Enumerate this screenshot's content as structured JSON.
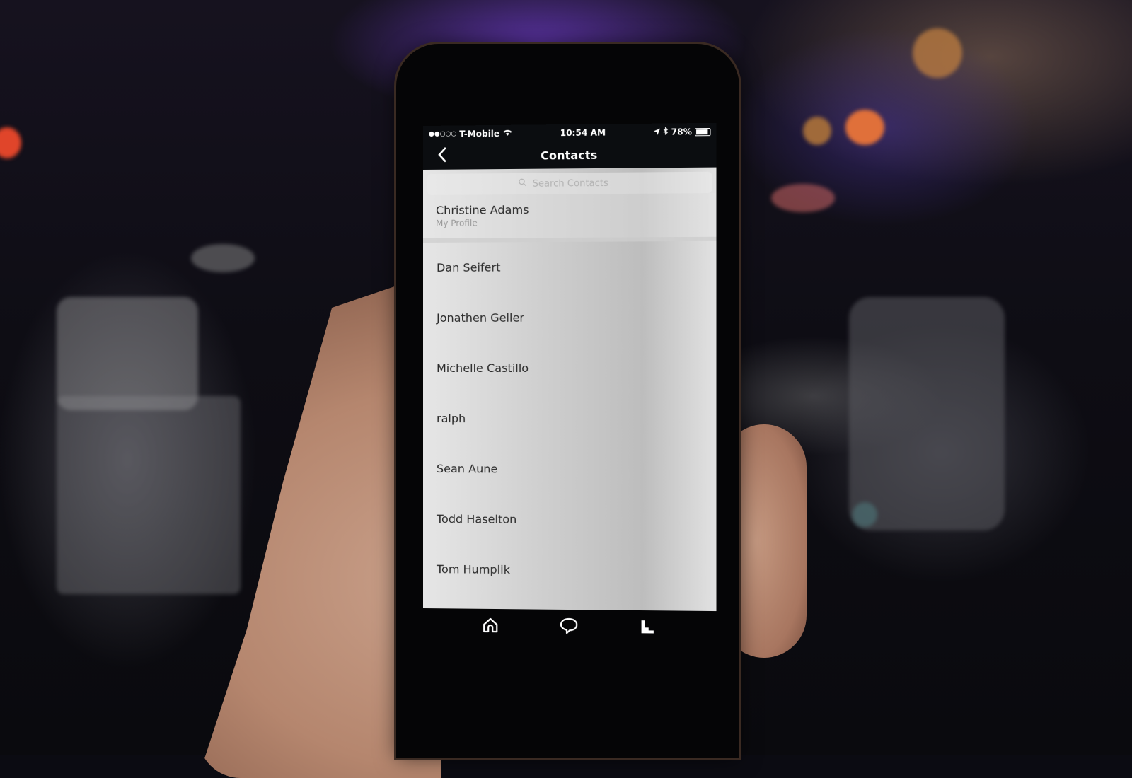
{
  "status_bar": {
    "signal": "●●○○○",
    "carrier": "T-Mobile",
    "wifi_icon": "wifi-icon",
    "time": "10:54 AM",
    "location_icon": "location-arrow-icon",
    "bluetooth_icon": "bluetooth-icon",
    "battery_percent": "78%",
    "battery_level": 0.78
  },
  "nav": {
    "title": "Contacts",
    "back_icon": "chevron-left-icon",
    "back_glyph": "‹"
  },
  "search": {
    "placeholder": "Search Contacts",
    "value": ""
  },
  "profile": {
    "name": "Christine Adams",
    "label": "My Profile"
  },
  "contacts": [
    {
      "name": "Dan Seifert"
    },
    {
      "name": "Jonathen Geller"
    },
    {
      "name": "Michelle Castillo"
    },
    {
      "name": "ralph"
    },
    {
      "name": "Sean Aune"
    },
    {
      "name": "Todd Haselton"
    },
    {
      "name": "Tom Humplik"
    }
  ],
  "tabs": [
    {
      "name": "home",
      "icon": "home-icon"
    },
    {
      "name": "conversations",
      "icon": "chat-bubble-icon"
    },
    {
      "name": "activity",
      "icon": "activity-bars-icon"
    }
  ],
  "colors": {
    "app_bar": "#0b0d10",
    "list_background": "#cfcfcf",
    "contact_text": "#2b2b2b",
    "secondary_text": "#9a9a9a"
  }
}
